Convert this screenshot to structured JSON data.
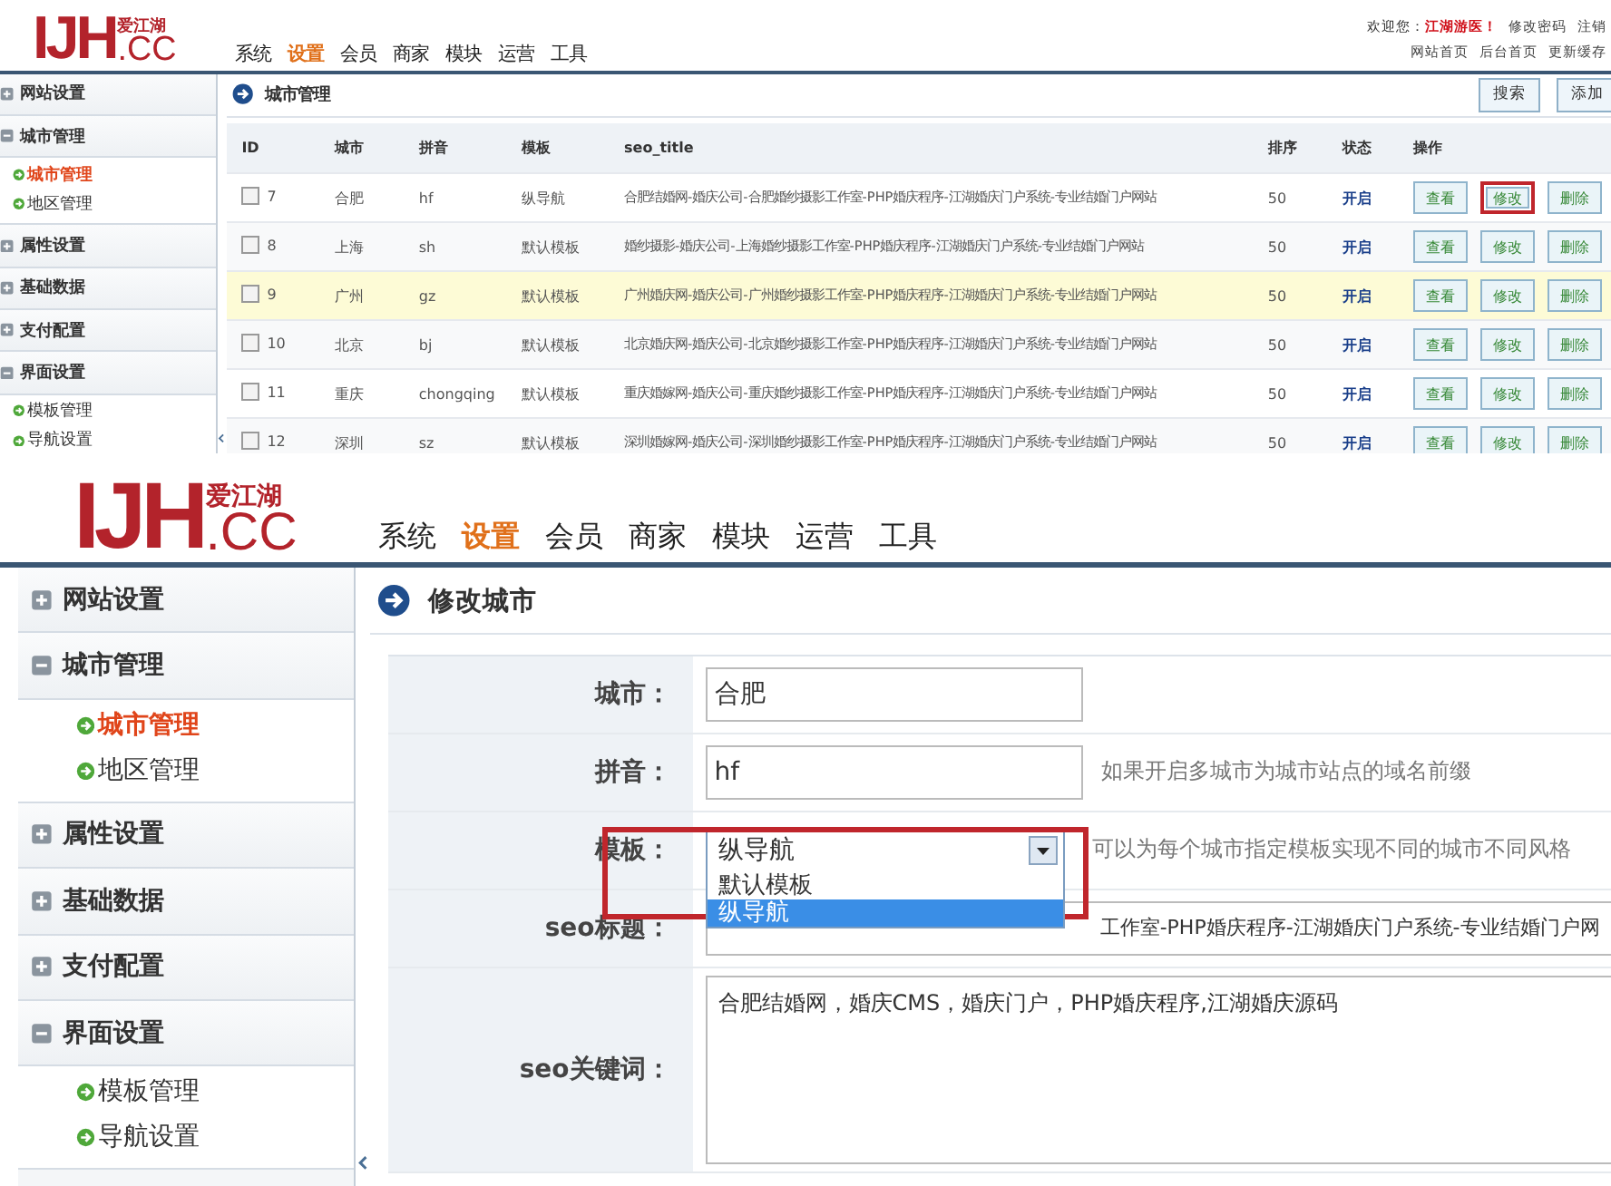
{
  "screens": [
    {
      "kind": "list",
      "header": {
        "logo": {
          "mark": "IJH",
          "domain": ".CC",
          "tagline": "爱江湖"
        },
        "nav": [
          {
            "label": "系统",
            "selected": false
          },
          {
            "label": "设置",
            "selected": true
          },
          {
            "label": "会员",
            "selected": false
          },
          {
            "label": "商家",
            "selected": false
          },
          {
            "label": "模块",
            "selected": false
          },
          {
            "label": "运营",
            "selected": false
          },
          {
            "label": "工具",
            "selected": false
          }
        ],
        "user_bar": {
          "greeting": "欢迎您：",
          "user": "江湖游医！",
          "links": [
            "修改密码",
            "注销"
          ],
          "shortcuts": [
            "网站首页",
            "后台首页",
            "更新缓存"
          ]
        }
      },
      "sidebar": [
        {
          "label": "网站设置",
          "expanded": false
        },
        {
          "label": "城市管理",
          "expanded": true,
          "children": [
            {
              "label": "城市管理",
              "selected": true
            },
            {
              "label": "地区管理",
              "selected": false
            }
          ]
        },
        {
          "label": "属性设置",
          "expanded": false
        },
        {
          "label": "基础数据",
          "expanded": false
        },
        {
          "label": "支付配置",
          "expanded": false
        },
        {
          "label": "界面设置",
          "expanded": true,
          "children": [
            {
              "label": "模板管理",
              "selected": false
            },
            {
              "label": "导航设置",
              "selected": false
            }
          ]
        }
      ],
      "main": {
        "title": "城市管理",
        "buttons": [
          "搜索",
          "添加"
        ],
        "table": {
          "columns": [
            "ID",
            "城市",
            "拼音",
            "模板",
            "seo_title",
            "排序",
            "状态",
            "操作"
          ],
          "rows": [
            {
              "checked": false,
              "id": "7",
              "city": "合肥",
              "pinyin": "hf",
              "template": "纵导航",
              "seo_title": "合肥结婚网-婚庆公司-合肥婚纱摄影工作室-PHP婚庆程序-江湖婚庆门户系统-专业结婚门户网站",
              "order": "50",
              "status": "开启",
              "hovered": false,
              "actions": [
                {
                  "label": "查看",
                  "highlighted": false
                },
                {
                  "label": "修改",
                  "highlighted": true
                },
                {
                  "label": "删除",
                  "highlighted": false
                }
              ]
            },
            {
              "checked": false,
              "id": "8",
              "city": "上海",
              "pinyin": "sh",
              "template": "默认模板",
              "seo_title": "婚纱摄影-婚庆公司-上海婚纱摄影工作室-PHP婚庆程序-江湖婚庆门户系统-专业结婚门户网站",
              "order": "50",
              "status": "开启",
              "hovered": false,
              "actions": [
                {
                  "label": "查看",
                  "highlighted": false
                },
                {
                  "label": "修改",
                  "highlighted": false
                },
                {
                  "label": "删除",
                  "highlighted": false
                }
              ]
            },
            {
              "checked": false,
              "id": "9",
              "city": "广州",
              "pinyin": "gz",
              "template": "默认模板",
              "seo_title": "广州婚庆网-婚庆公司-广州婚纱摄影工作室-PHP婚庆程序-江湖婚庆门户系统-专业结婚门户网站",
              "order": "50",
              "status": "开启",
              "hovered": true,
              "actions": [
                {
                  "label": "查看",
                  "highlighted": false
                },
                {
                  "label": "修改",
                  "highlighted": false
                },
                {
                  "label": "删除",
                  "highlighted": false
                }
              ]
            },
            {
              "checked": false,
              "id": "10",
              "city": "北京",
              "pinyin": "bj",
              "template": "默认模板",
              "seo_title": "北京婚庆网-婚庆公司-北京婚纱摄影工作室-PHP婚庆程序-江湖婚庆门户系统-专业结婚门户网站",
              "order": "50",
              "status": "开启",
              "hovered": false,
              "actions": [
                {
                  "label": "查看",
                  "highlighted": false
                },
                {
                  "label": "修改",
                  "highlighted": false
                },
                {
                  "label": "删除",
                  "highlighted": false
                }
              ]
            },
            {
              "checked": false,
              "id": "11",
              "city": "重庆",
              "pinyin": "chongqing",
              "template": "默认模板",
              "seo_title": "重庆婚嫁网-婚庆公司-重庆婚纱摄影工作室-PHP婚庆程序-江湖婚庆门户系统-专业结婚门户网站",
              "order": "50",
              "status": "开启",
              "hovered": false,
              "actions": [
                {
                  "label": "查看",
                  "highlighted": false
                },
                {
                  "label": "修改",
                  "highlighted": false
                },
                {
                  "label": "删除",
                  "highlighted": false
                }
              ]
            },
            {
              "checked": false,
              "id": "12",
              "city": "深圳",
              "pinyin": "sz",
              "template": "默认模板",
              "seo_title": "深圳婚嫁网-婚庆公司-深圳婚纱摄影工作室-PHP婚庆程序-江湖婚庆门户系统-专业结婚门户网站",
              "order": "50",
              "status": "开启",
              "hovered": false,
              "actions": [
                {
                  "label": "查看",
                  "highlighted": false
                },
                {
                  "label": "修改",
                  "highlighted": false
                },
                {
                  "label": "删除",
                  "highlighted": false
                }
              ]
            }
          ]
        }
      }
    },
    {
      "kind": "edit",
      "header": {
        "logo": {
          "mark": "IJH",
          "domain": ".CC",
          "tagline": "爱江湖"
        },
        "nav": [
          {
            "label": "系统",
            "selected": false
          },
          {
            "label": "设置",
            "selected": true
          },
          {
            "label": "会员",
            "selected": false
          },
          {
            "label": "商家",
            "selected": false
          },
          {
            "label": "模块",
            "selected": false
          },
          {
            "label": "运营",
            "selected": false
          },
          {
            "label": "工具",
            "selected": false
          }
        ]
      },
      "sidebar": [
        {
          "label": "网站设置",
          "expanded": false
        },
        {
          "label": "城市管理",
          "expanded": true,
          "children": [
            {
              "label": "城市管理",
              "selected": true
            },
            {
              "label": "地区管理",
              "selected": false
            }
          ]
        },
        {
          "label": "属性设置",
          "expanded": false
        },
        {
          "label": "基础数据",
          "expanded": false
        },
        {
          "label": "支付配置",
          "expanded": false
        },
        {
          "label": "界面设置",
          "expanded": true,
          "children": [
            {
              "label": "模板管理",
              "selected": false
            },
            {
              "label": "导航设置",
              "selected": false
            }
          ]
        }
      ],
      "main": {
        "title": "修改城市",
        "fields": [
          {
            "kind": "text",
            "label": "城市：",
            "value": "合肥",
            "highlighted": false
          },
          {
            "kind": "text",
            "label": "拼音：",
            "value": "hf",
            "hint": "如果开启多城市为城市站点的域名前缀",
            "highlighted": false
          },
          {
            "kind": "select",
            "label": "模板：",
            "value": "纵导航",
            "hint": "可以为每个城市指定模板实现不同的城市不同风格",
            "highlighted": true,
            "options": [
              {
                "label": "默认模板",
                "selected": false
              },
              {
                "label": "纵导航",
                "selected": true
              }
            ]
          },
          {
            "kind": "text",
            "label": "seo标题：",
            "value": "工作室-PHP婚庆程序-江湖婚庆门户系统-专业结婚门户网",
            "highlighted": false
          },
          {
            "kind": "textarea",
            "label": "seo关键词：",
            "value": "合肥结婚网，婚庆CMS，婚庆门户，PHP婚庆程序,江湖婚庆源码",
            "highlighted": false
          }
        ]
      }
    }
  ]
}
